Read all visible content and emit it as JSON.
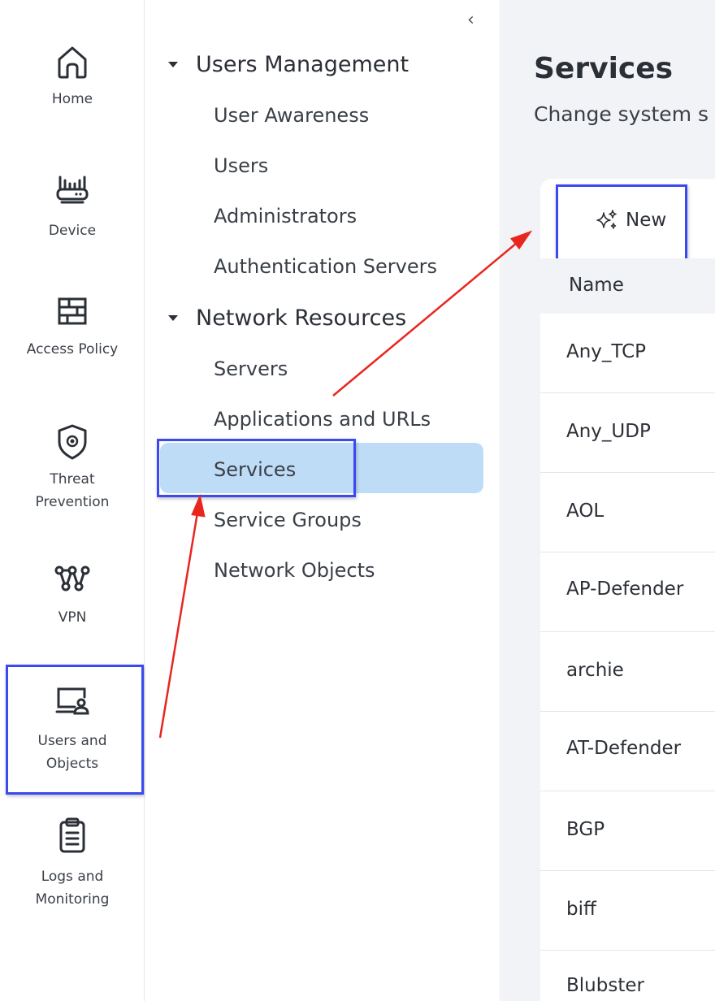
{
  "rail": {
    "items": [
      {
        "label": "Home",
        "icon": "home-icon"
      },
      {
        "label": "Device",
        "icon": "device-icon"
      },
      {
        "label": "Access Policy",
        "icon": "firewall-icon"
      },
      {
        "label": "Threat Prevention",
        "icon": "shield-icon"
      },
      {
        "label": "VPN",
        "icon": "vpn-icon"
      },
      {
        "label": "Users and Objects",
        "icon": "users-objects-icon"
      },
      {
        "label": "Logs and Monitoring",
        "icon": "clipboard-icon"
      }
    ],
    "selected": "Users and Objects"
  },
  "tree": {
    "collapse_glyph": "‹",
    "groups": [
      {
        "label": "Users Management",
        "items": [
          "User Awareness",
          "Users",
          "Administrators",
          "Authentication Servers"
        ]
      },
      {
        "label": "Network Resources",
        "items": [
          "Servers",
          "Applications and URLs",
          "Services",
          "Service Groups",
          "Network Objects"
        ]
      }
    ],
    "selected": "Services"
  },
  "main": {
    "title": "Services",
    "subtitle": "Change system s",
    "toolbar": {
      "new_label": "New",
      "new_icon": "sparkle-icon"
    },
    "table": {
      "columns": [
        "Name"
      ],
      "rows": [
        "Any_TCP",
        "Any_UDP",
        "AOL",
        "AP-Defender",
        "archie",
        "AT-Defender",
        "BGP",
        "biff",
        "Blubster"
      ]
    }
  },
  "annotations": {
    "highlight_color": "#3b49f1",
    "arrow_color": "#e8261e"
  }
}
